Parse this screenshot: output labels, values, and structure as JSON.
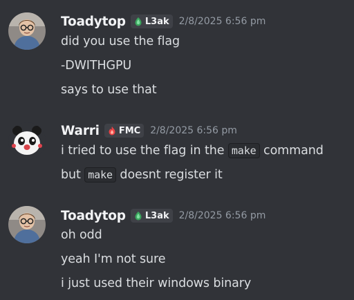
{
  "messages": [
    {
      "author": "Toadytop",
      "avatar": "toadytop-avatar",
      "tag": {
        "label": "L3ak",
        "icon": "green-gem-icon",
        "color": "#3ba55d"
      },
      "timestamp": "2/8/2025 6:56 pm",
      "lines": [
        "did you use the flag",
        "-DWITHGPU",
        "says to use that"
      ]
    },
    {
      "author": "Warri",
      "avatar": "warri-panda-avatar",
      "tag": {
        "label": "FMC",
        "icon": "flame-icon",
        "color": "#ed4245"
      },
      "timestamp": "2/8/2025 6:56 pm",
      "lines": [
        {
          "pre": "i tried to use the flag in the ",
          "code": "make",
          "post": " command"
        },
        {
          "pre": "but ",
          "code": "make",
          "post": " doesnt register it"
        }
      ]
    },
    {
      "author": "Toadytop",
      "avatar": "toadytop-avatar",
      "tag": {
        "label": "L3ak",
        "icon": "green-gem-icon",
        "color": "#3ba55d"
      },
      "timestamp": "2/8/2025 6:56 pm",
      "lines": [
        "oh odd",
        "yeah I'm not sure",
        "i just used their windows binary"
      ]
    }
  ]
}
